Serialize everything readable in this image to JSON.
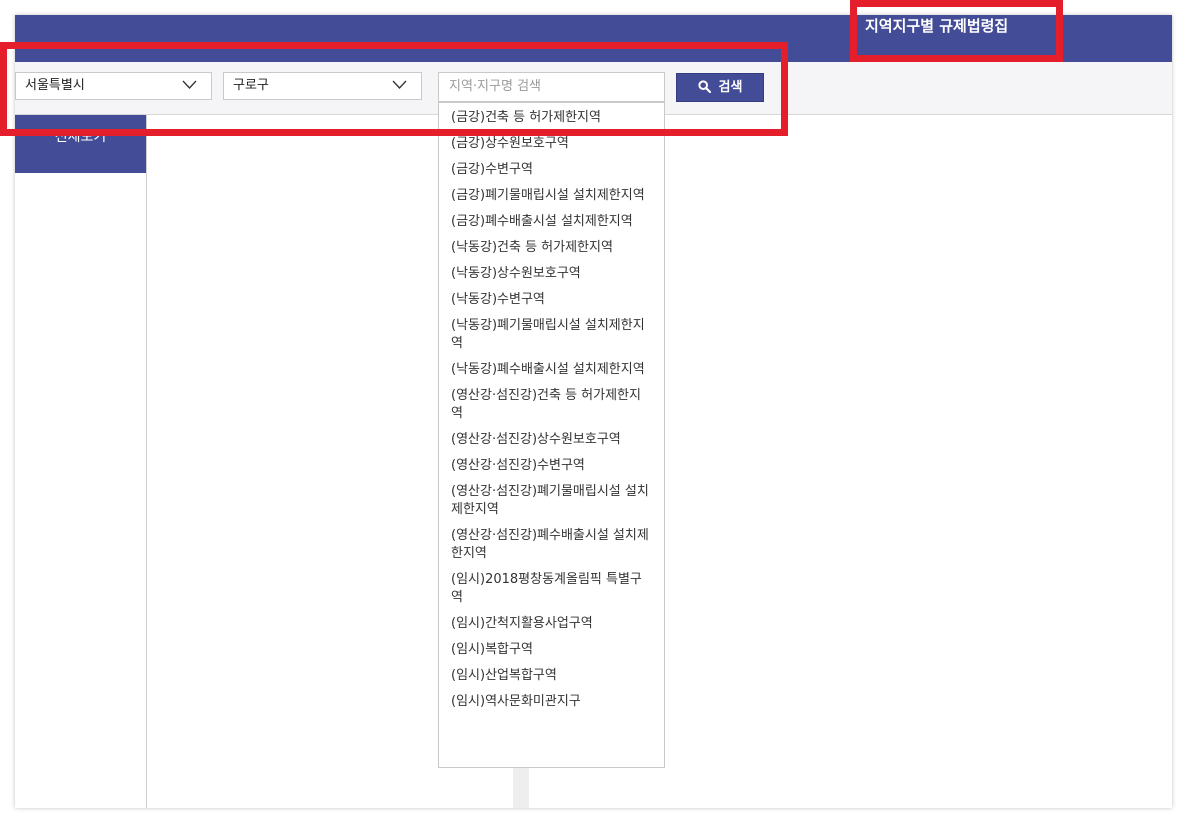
{
  "header": {
    "title": "지역지구별 규제법령집"
  },
  "search": {
    "region_select": "서울특별시",
    "district_select": "구로구",
    "input_placeholder": "지역·지구명 검색",
    "button_label": "검색"
  },
  "sidebar": {
    "active_item": "전체보기"
  },
  "dropdown": {
    "items": [
      "(금강)건축 등 허가제한지역",
      "(금강)상수원보호구역",
      "(금강)수변구역",
      "(금강)폐기물매립시설 설치제한지역",
      "(금강)폐수배출시설 설치제한지역",
      "(낙동강)건축 등 허가제한지역",
      "(낙동강)상수원보호구역",
      "(낙동강)수변구역",
      "(낙동강)폐기물매립시설 설치제한지역",
      "(낙동강)폐수배출시설 설치제한지역",
      "(영산강·섬진강)건축 등 허가제한지역",
      "(영산강·섬진강)상수원보호구역",
      "(영산강·섬진강)수변구역",
      "(영산강·섬진강)폐기물매립시설 설치제한지역",
      "(영산강·섬진강)폐수배출시설 설치제한지역",
      "(임시)2018평창동계올림픽 특별구역",
      "(임시)간척지활용사업구역",
      "(임시)복합구역",
      "(임시)산업복합구역",
      "(임시)역사문화미관지구"
    ]
  },
  "colors": {
    "brand": "#434c96",
    "highlight": "#e41e2a"
  }
}
